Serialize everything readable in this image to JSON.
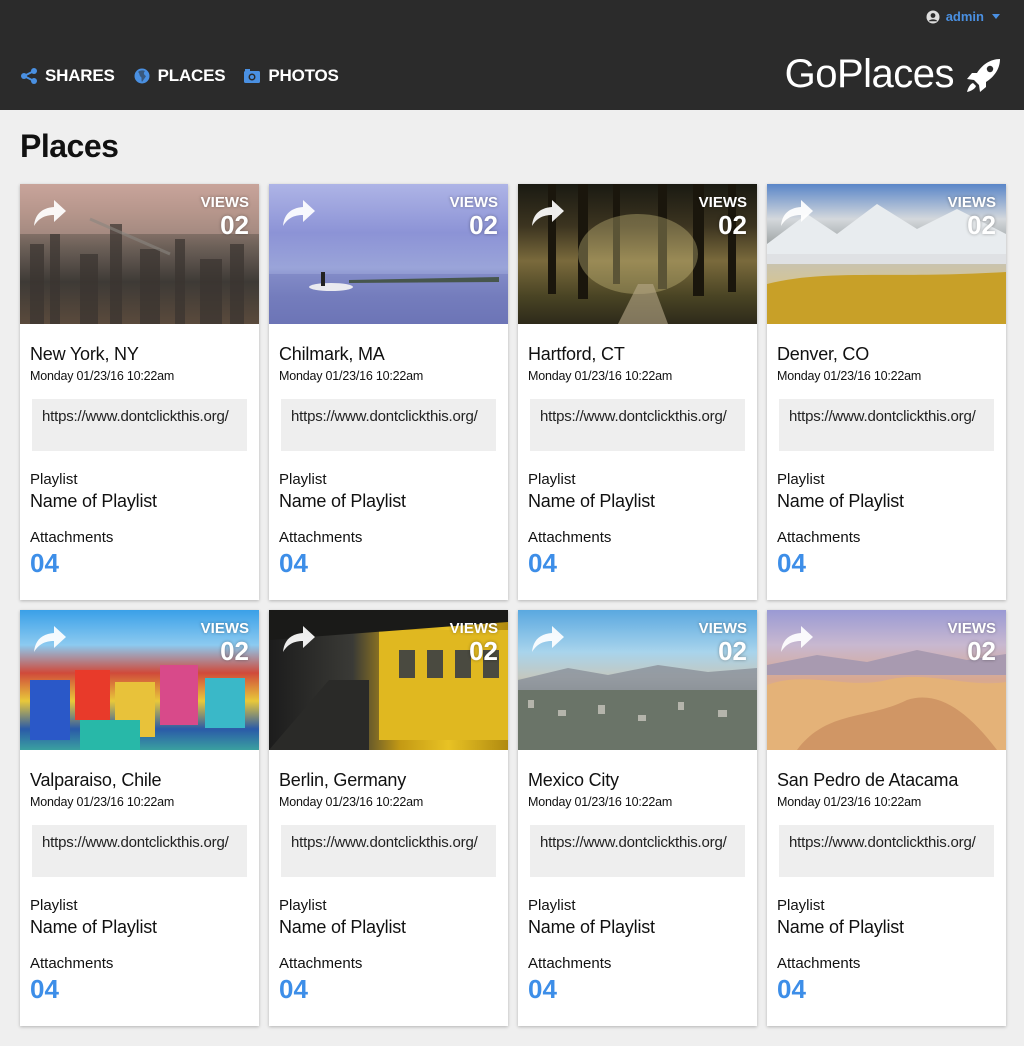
{
  "header": {
    "user_name": "admin",
    "nav": [
      {
        "label": "SHARES",
        "icon": "share-icon"
      },
      {
        "label": "PLACES",
        "icon": "globe-icon"
      },
      {
        "label": "PHOTOS",
        "icon": "camera-icon"
      }
    ],
    "brand": "GoPlaces",
    "brand_icon": "rocket-icon"
  },
  "page": {
    "title": "Places"
  },
  "colors": {
    "accent": "#3d8ee8",
    "header_bg": "#2b2b2b"
  },
  "cards": [
    {
      "name": "New York, NY",
      "date": "Monday 01/23/16 10:22am",
      "url": "https://www.dontclickthis.org/",
      "playlist_label": "Playlist",
      "playlist": "Name of Playlist",
      "attachments_label": "Attachments",
      "attachments": "04",
      "views_label": "VIEWS",
      "views": "02"
    },
    {
      "name": "Chilmark, MA",
      "date": "Monday 01/23/16 10:22am",
      "url": "https://www.dontclickthis.org/",
      "playlist_label": "Playlist",
      "playlist": "Name of Playlist",
      "attachments_label": "Attachments",
      "attachments": "04",
      "views_label": "VIEWS",
      "views": "02"
    },
    {
      "name": "Hartford, CT",
      "date": "Monday 01/23/16 10:22am",
      "url": "https://www.dontclickthis.org/",
      "playlist_label": "Playlist",
      "playlist": "Name of Playlist",
      "attachments_label": "Attachments",
      "attachments": "04",
      "views_label": "VIEWS",
      "views": "02"
    },
    {
      "name": "Denver, CO",
      "date": "Monday 01/23/16 10:22am",
      "url": "https://www.dontclickthis.org/",
      "playlist_label": "Playlist",
      "playlist": "Name of Playlist",
      "attachments_label": "Attachments",
      "attachments": "04",
      "views_label": "VIEWS",
      "views": "02"
    },
    {
      "name": "Valparaiso, Chile",
      "date": "Monday 01/23/16 10:22am",
      "url": "https://www.dontclickthis.org/",
      "playlist_label": "Playlist",
      "playlist": "Name of Playlist",
      "attachments_label": "Attachments",
      "attachments": "04",
      "views_label": "VIEWS",
      "views": "02"
    },
    {
      "name": "Berlin, Germany",
      "date": "Monday 01/23/16 10:22am",
      "url": "https://www.dontclickthis.org/",
      "playlist_label": "Playlist",
      "playlist": "Name of Playlist",
      "attachments_label": "Attachments",
      "attachments": "04",
      "views_label": "VIEWS",
      "views": "02"
    },
    {
      "name": "Mexico City",
      "date": "Monday 01/23/16 10:22am",
      "url": "https://www.dontclickthis.org/",
      "playlist_label": "Playlist",
      "playlist": "Name of Playlist",
      "attachments_label": "Attachments",
      "attachments": "04",
      "views_label": "VIEWS",
      "views": "02"
    },
    {
      "name": "San Pedro de Atacama",
      "date": "Monday 01/23/16 10:22am",
      "url": "https://www.dontclickthis.org/",
      "playlist_label": "Playlist",
      "playlist": "Name of Playlist",
      "attachments_label": "Attachments",
      "attachments": "04",
      "views_label": "VIEWS",
      "views": "02"
    }
  ]
}
